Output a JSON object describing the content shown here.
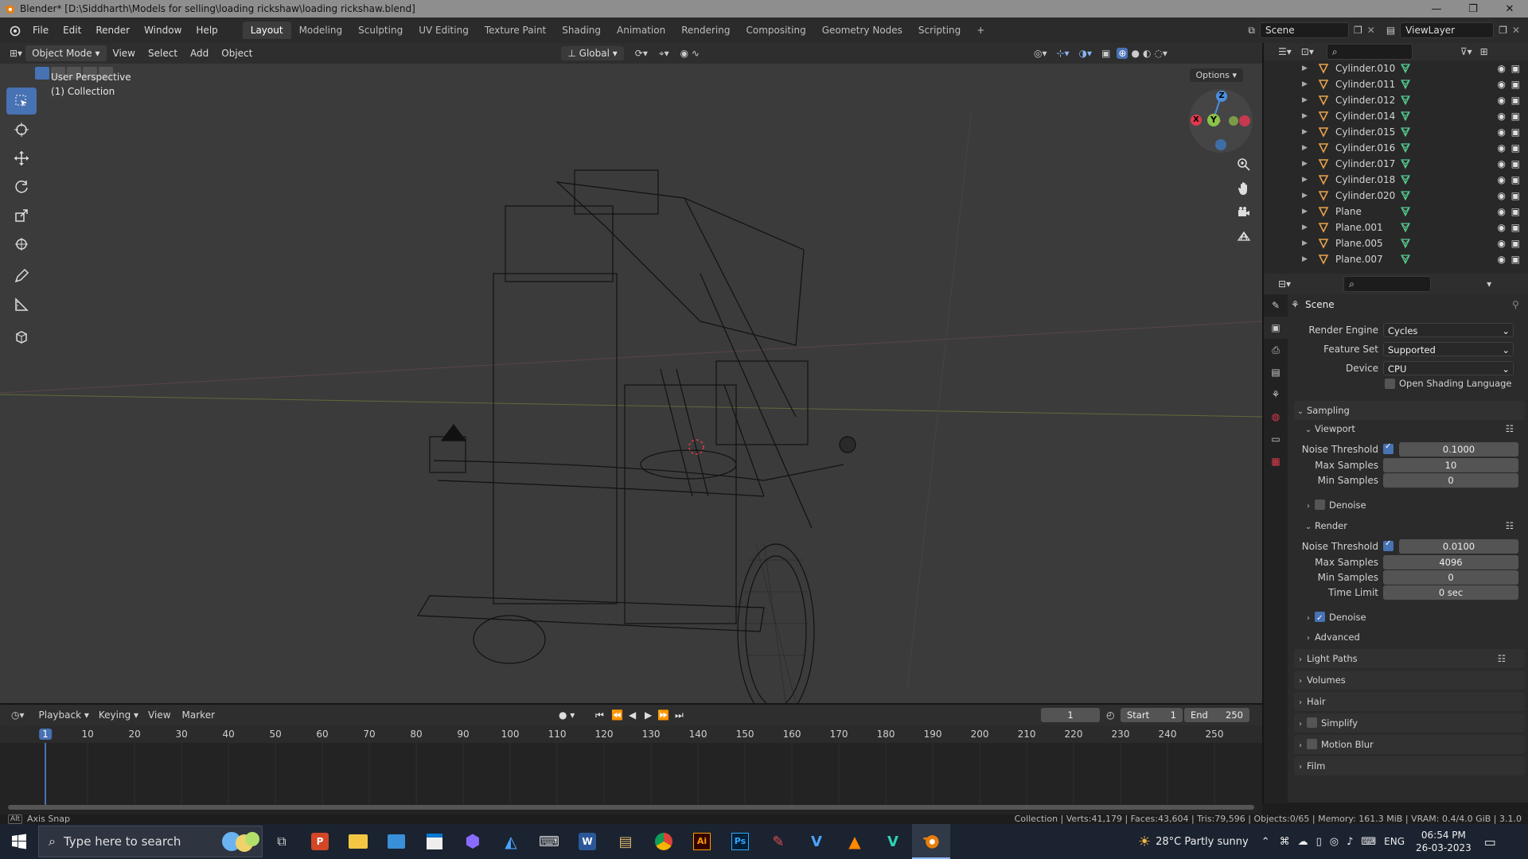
{
  "window": {
    "title": "Blender* [D:\\Siddharth\\Models for selling\\loading rickshaw\\loading rickshaw.blend]",
    "controls": [
      "—",
      "❐",
      "✕"
    ]
  },
  "menubar": {
    "menus": [
      "File",
      "Edit",
      "Render",
      "Window",
      "Help"
    ],
    "workspaces": [
      "Layout",
      "Modeling",
      "Sculpting",
      "UV Editing",
      "Texture Paint",
      "Shading",
      "Animation",
      "Rendering",
      "Compositing",
      "Geometry Nodes",
      "Scripting"
    ],
    "active_workspace": "Layout",
    "add_tab": "+",
    "scene": "Scene",
    "view_layer": "ViewLayer"
  },
  "viewport": {
    "mode": "Object Mode",
    "menus": [
      "View",
      "Select",
      "Add",
      "Object"
    ],
    "transform_orientation": "Global",
    "options_label": "Options",
    "info_line1": "User Perspective",
    "info_line2": "(1) Collection",
    "gizmo_axes": {
      "x": "X",
      "y": "Y",
      "z": "Z"
    },
    "colors": {
      "x": "#e0394e",
      "y": "#8bc34a",
      "z": "#4a8fe0"
    }
  },
  "outliner": {
    "items": [
      {
        "name": "Cylinder.010"
      },
      {
        "name": "Cylinder.011"
      },
      {
        "name": "Cylinder.012"
      },
      {
        "name": "Cylinder.014"
      },
      {
        "name": "Cylinder.015"
      },
      {
        "name": "Cylinder.016"
      },
      {
        "name": "Cylinder.017"
      },
      {
        "name": "Cylinder.018"
      },
      {
        "name": "Cylinder.020"
      },
      {
        "name": "Plane"
      },
      {
        "name": "Plane.001"
      },
      {
        "name": "Plane.005"
      },
      {
        "name": "Plane.007"
      }
    ]
  },
  "properties": {
    "context": "Scene",
    "render_engine_label": "Render Engine",
    "render_engine": "Cycles",
    "feature_set_label": "Feature Set",
    "feature_set": "Supported",
    "device_label": "Device",
    "device": "CPU",
    "osl_label": "Open Shading Language",
    "sampling": "Sampling",
    "viewport": {
      "title": "Viewport",
      "noise_threshold_label": "Noise Threshold",
      "noise_threshold": "0.1000",
      "max_samples_label": "Max Samples",
      "max_samples": "10",
      "min_samples_label": "Min Samples",
      "min_samples": "0",
      "denoise_label": "Denoise"
    },
    "render": {
      "title": "Render",
      "noise_threshold_label": "Noise Threshold",
      "noise_threshold": "0.0100",
      "max_samples_label": "Max Samples",
      "max_samples": "4096",
      "min_samples_label": "Min Samples",
      "min_samples": "0",
      "time_limit_label": "Time Limit",
      "time_limit": "0 sec",
      "denoise_label": "Denoise"
    },
    "advanced": "Advanced",
    "sections": [
      "Light Paths",
      "Volumes",
      "Hair",
      "Simplify",
      "Motion Blur",
      "Film"
    ]
  },
  "timeline": {
    "menus": [
      "Playback",
      "Keying",
      "View",
      "Marker"
    ],
    "current_frame": "1",
    "start_label": "Start",
    "start": "1",
    "end_label": "End",
    "end": "250",
    "ticks": [
      "1",
      "10",
      "20",
      "30",
      "40",
      "50",
      "60",
      "70",
      "80",
      "90",
      "100",
      "110",
      "120",
      "130",
      "140",
      "150",
      "160",
      "170",
      "180",
      "190",
      "200",
      "210",
      "220",
      "230",
      "240",
      "250"
    ]
  },
  "statusbar": {
    "left": "Axis Snap",
    "right": "Collection | Verts:41,179 | Faces:43,604 | Tris:79,596 | Objects:0/65 | Memory: 161.3 MiB | VRAM: 0.4/4.0 GiB | 3.1.0"
  },
  "taskbar": {
    "search_placeholder": "Type here to search",
    "weather": "28°C  Partly sunny",
    "language": "ENG",
    "time": "06:54 PM",
    "date": "26-03-2023"
  }
}
